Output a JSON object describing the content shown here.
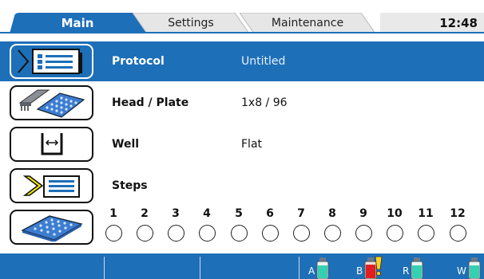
{
  "tabs": [
    {
      "label": "Main",
      "active": true
    },
    {
      "label": "Settings",
      "active": false
    },
    {
      "label": "Maintenance",
      "active": false
    }
  ],
  "clock": "12:48",
  "rows": {
    "protocol": {
      "label": "Protocol",
      "value": "Untitled",
      "icon": "protocol-list-icon",
      "selected": true
    },
    "head_plate": {
      "label": "Head / Plate",
      "value": "1x8 / 96",
      "icon": "dispense-head-plate-icon"
    },
    "well": {
      "label": "Well",
      "value": "Flat",
      "icon": "well-shape-icon"
    },
    "steps": {
      "label": "Steps",
      "icon": "steps-list-icon"
    }
  },
  "columns": {
    "icon": "microplate-icon",
    "numbers": [
      "1",
      "2",
      "3",
      "4",
      "5",
      "6",
      "7",
      "8",
      "9",
      "10",
      "11",
      "12"
    ]
  },
  "reagents": [
    {
      "letter": "A",
      "color": "#35d0b0",
      "icon": "bottle-icon"
    },
    {
      "letter": "B",
      "color": "#e02020",
      "icon": "bottle-warning-icon",
      "warning": true
    },
    {
      "letter": "R",
      "color": "#35d0b0",
      "icon": "bottle-icon"
    },
    {
      "letter": "W",
      "color": "#35d0b0",
      "icon": "bottle-icon"
    }
  ],
  "colors": {
    "accent": "#1d6fb8",
    "warning": "#ffd21a"
  }
}
